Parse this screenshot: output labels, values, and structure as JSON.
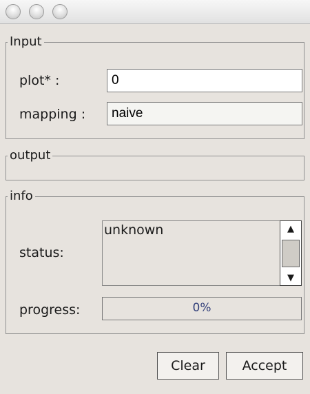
{
  "window": {
    "title_buttons": [
      "close-icon",
      "minimize-icon",
      "zoom-icon"
    ]
  },
  "input": {
    "title": "Input",
    "plot_label": "plot* :",
    "plot_value": "0",
    "mapping_label": "mapping :",
    "mapping_value": "naive"
  },
  "output": {
    "title": "output"
  },
  "info": {
    "title": "info",
    "status_label": "status:",
    "status_value": "unknown",
    "progress_label": "progress:",
    "progress_value": 0,
    "progress_text": "0%"
  },
  "buttons": {
    "clear": "Clear",
    "accept": "Accept"
  }
}
